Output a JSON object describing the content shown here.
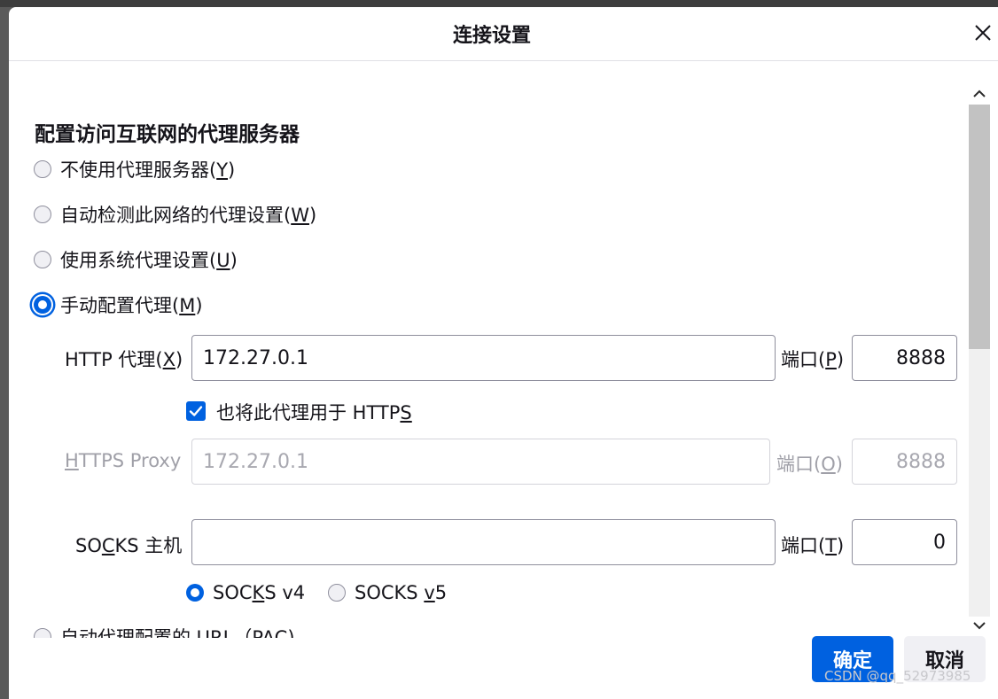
{
  "dialog": {
    "title": "连接设置"
  },
  "section": {
    "title": "配置访问互联网的代理服务器"
  },
  "options": {
    "no_proxy": {
      "label": "不使用代理服务器(",
      "key": "Y",
      "end": ")"
    },
    "auto_detect": {
      "label": "自动检测此网络的代理设置(",
      "key": "W",
      "end": ")"
    },
    "system": {
      "label": "使用系统代理设置(",
      "key": "U",
      "end": ")"
    },
    "manual": {
      "label": "手动配置代理(",
      "key": "M",
      "end": ")",
      "checked": true
    },
    "pac": {
      "label": "自动代理配置的 URL（PAC)"
    }
  },
  "http": {
    "label": "HTTP 代理(",
    "key": "X",
    "end": ")",
    "value": "172.27.0.1",
    "port_label": "端口(",
    "port_key": "P",
    "port_end": ")",
    "port": "8888"
  },
  "also_https": {
    "label": "也将此代理用于 HTTP",
    "key": "S",
    "checked": true
  },
  "https": {
    "pre": "",
    "key": "H",
    "label": "TTPS Proxy",
    "value": "172.27.0.1",
    "port_label": "端口(",
    "port_key": "O",
    "port_end": ")",
    "port": "8888"
  },
  "socks": {
    "pre": "SO",
    "key": "C",
    "label": "KS 主机",
    "value": "",
    "port_label": "端口(",
    "port_key": "T",
    "port_end": ")",
    "port": "0"
  },
  "socks_v4": {
    "pre": "SOC",
    "key": "K",
    "post": "S v4",
    "checked": true
  },
  "socks_v5": {
    "pre": "SOCKS ",
    "key": "v",
    "post": "5",
    "checked": false
  },
  "buttons": {
    "ok": "确定",
    "cancel": "取消"
  },
  "watermark": "CSDN @qq_52973985",
  "colors": {
    "accent": "#0061e0",
    "overlay": "#5a5a5a"
  },
  "icons": {
    "close": "close-icon",
    "check": "checkmark-icon",
    "scroll_up": "chevron-up-icon",
    "scroll_down": "chevron-down-icon"
  }
}
